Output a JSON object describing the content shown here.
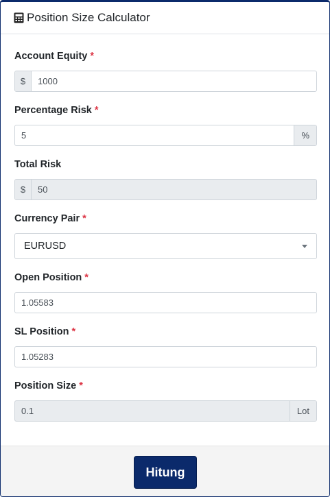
{
  "header": {
    "title": "Position Size Calculator",
    "icon": "calculator-icon"
  },
  "fields": {
    "account_equity": {
      "label": "Account Equity",
      "required": "*",
      "prefix": "$",
      "value": "1000"
    },
    "percentage_risk": {
      "label": "Percentage Risk",
      "required": "*",
      "suffix": "%",
      "value": "5"
    },
    "total_risk": {
      "label": "Total Risk",
      "prefix": "$",
      "value": "50"
    },
    "currency_pair": {
      "label": "Currency Pair",
      "required": "*",
      "selected": "EURUSD"
    },
    "open_position": {
      "label": "Open Position",
      "required": "*",
      "value": "1.05583"
    },
    "sl_position": {
      "label": "SL Position",
      "required": "*",
      "value": "1.05283"
    },
    "position_size": {
      "label": "Position Size",
      "required": "*",
      "value": "0.1",
      "suffix": "Lot"
    }
  },
  "footer": {
    "submit_label": "Hitung"
  },
  "colors": {
    "primary": "#0b2a6b",
    "required": "#dc3545",
    "readonly_bg": "#e9ecef"
  }
}
